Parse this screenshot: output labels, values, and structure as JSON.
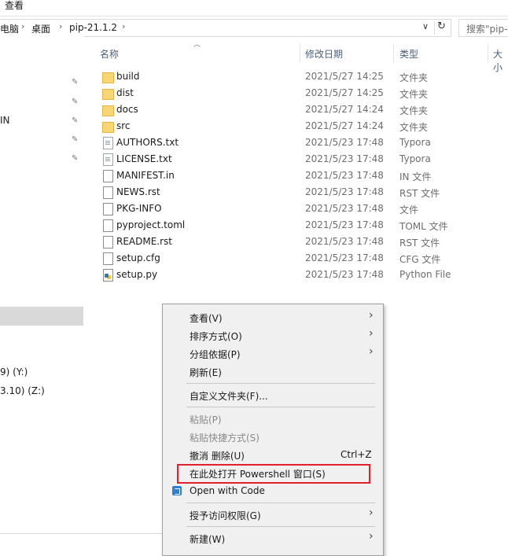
{
  "ribbon": {
    "tab_view": "查看"
  },
  "address": {
    "crumbs": [
      "电脑",
      "桌面",
      "pip-21.1.2"
    ],
    "dropdown_icon": "chevron-down-icon",
    "refresh_icon": "refresh-icon"
  },
  "search": {
    "placeholder": "搜索\"pip-"
  },
  "nav": {
    "item_in": "IN",
    "drive_y": "9) (Y:)",
    "drive_z": "3.10) (Z:)"
  },
  "columns": {
    "name": "名称",
    "date": "修改日期",
    "type": "类型",
    "size": "大小"
  },
  "files": [
    {
      "name": "build",
      "date": "2021/5/27 14:25",
      "type": "文件夹",
      "icon": "folder-icon"
    },
    {
      "name": "dist",
      "date": "2021/5/27 14:25",
      "type": "文件夹",
      "icon": "folder-icon"
    },
    {
      "name": "docs",
      "date": "2021/5/27 14:24",
      "type": "文件夹",
      "icon": "folder-icon"
    },
    {
      "name": "src",
      "date": "2021/5/27 14:24",
      "type": "文件夹",
      "icon": "folder-icon"
    },
    {
      "name": "AUTHORS.txt",
      "date": "2021/5/23 17:48",
      "type": "Typora",
      "icon": "text-file-icon"
    },
    {
      "name": "LICENSE.txt",
      "date": "2021/5/23 17:48",
      "type": "Typora",
      "icon": "text-file-icon"
    },
    {
      "name": "MANIFEST.in",
      "date": "2021/5/23 17:48",
      "type": "IN 文件",
      "icon": "file-icon"
    },
    {
      "name": "NEWS.rst",
      "date": "2021/5/23 17:48",
      "type": "RST 文件",
      "icon": "file-icon"
    },
    {
      "name": "PKG-INFO",
      "date": "2021/5/23 17:48",
      "type": "文件",
      "icon": "file-icon"
    },
    {
      "name": "pyproject.toml",
      "date": "2021/5/23 17:48",
      "type": "TOML 文件",
      "icon": "file-icon"
    },
    {
      "name": "README.rst",
      "date": "2021/5/23 17:48",
      "type": "RST 文件",
      "icon": "file-icon"
    },
    {
      "name": "setup.cfg",
      "date": "2021/5/23 17:48",
      "type": "CFG 文件",
      "icon": "file-icon"
    },
    {
      "name": "setup.py",
      "date": "2021/5/23 17:48",
      "type": "Python File",
      "icon": "python-file-icon"
    }
  ],
  "menu": {
    "view": "查看(V)",
    "sort": "排序方式(O)",
    "group": "分组依据(P)",
    "refresh": "刷新(E)",
    "customize": "自定义文件夹(F)...",
    "paste": "粘贴(P)",
    "paste_shortcut": "粘贴快捷方式(S)",
    "undo": "撤消 删除(U)",
    "undo_shortcut": "Ctrl+Z",
    "powershell": "在此处打开 Powershell 窗口(S)",
    "open_code": "Open with Code",
    "grant_access": "授予访问权限(G)",
    "new": "新建(W)"
  },
  "colors": {
    "highlight_border": "#e0202a",
    "menu_bg": "#f0f0f0",
    "folder": "#f8d675"
  }
}
